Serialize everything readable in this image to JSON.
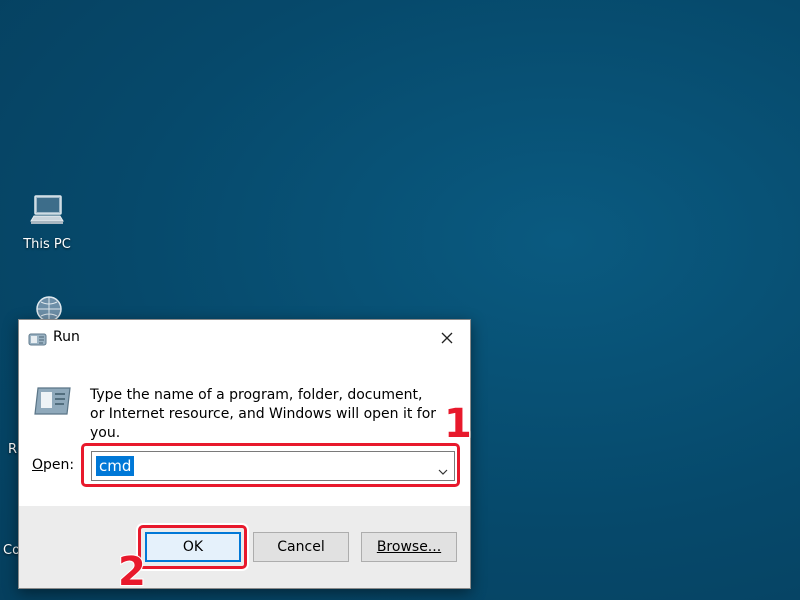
{
  "desktop": {
    "background_color": "#06496b",
    "icons": [
      {
        "label": "This PC",
        "icon": "computer-icon"
      },
      {
        "label": "",
        "icon": "network-icon"
      }
    ],
    "partial_labels": [
      "R",
      "Co"
    ]
  },
  "run_dialog": {
    "title": "Run",
    "description": "Type the name of a program, folder, document, or Internet resource, and Windows will open it for you.",
    "open_label": "Open:",
    "open_label_accesskey": "O",
    "open_value": "cmd",
    "buttons": {
      "ok": "OK",
      "cancel": "Cancel",
      "browse": "Browse..."
    }
  },
  "annotations": {
    "step1": "1",
    "step2": "2",
    "highlight_color": "#e8192c"
  }
}
